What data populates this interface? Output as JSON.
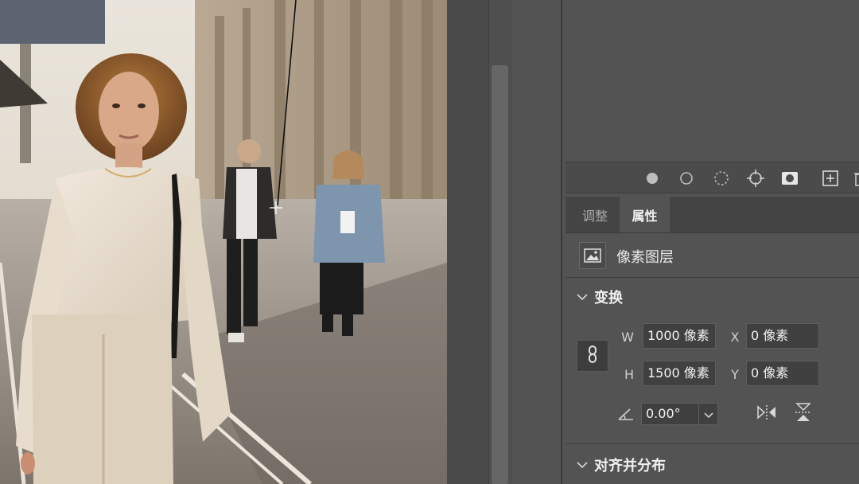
{
  "panel": {
    "tabs": [
      {
        "label": "调整",
        "active": false
      },
      {
        "label": "属性",
        "active": true
      }
    ],
    "layer_kind": {
      "icon": "image-icon",
      "label": "像素图层"
    },
    "icon_bar": [
      {
        "icon": "filled-circle-icon"
      },
      {
        "icon": "outline-circle-icon"
      },
      {
        "icon": "dashed-circle-icon"
      },
      {
        "icon": "crosshair-target-icon"
      },
      {
        "icon": "mask-icon"
      },
      {
        "icon": "add-square-icon"
      },
      {
        "icon": "trash-icon"
      }
    ],
    "transform": {
      "title": "变换",
      "w_label": "W",
      "w_value": "1000 像素",
      "h_label": "H",
      "h_value": "1500 像素",
      "x_label": "X",
      "x_value": "0 像素",
      "y_label": "Y",
      "y_value": "0 像素",
      "angle_value": "0.00°",
      "link_icon": "link-icon"
    },
    "align": {
      "title": "对齐并分布"
    }
  },
  "colors": {
    "panel_bg": "#535353",
    "tab_bar_bg": "#444444",
    "field_bg": "#404040",
    "text": "#e6e6e6"
  }
}
